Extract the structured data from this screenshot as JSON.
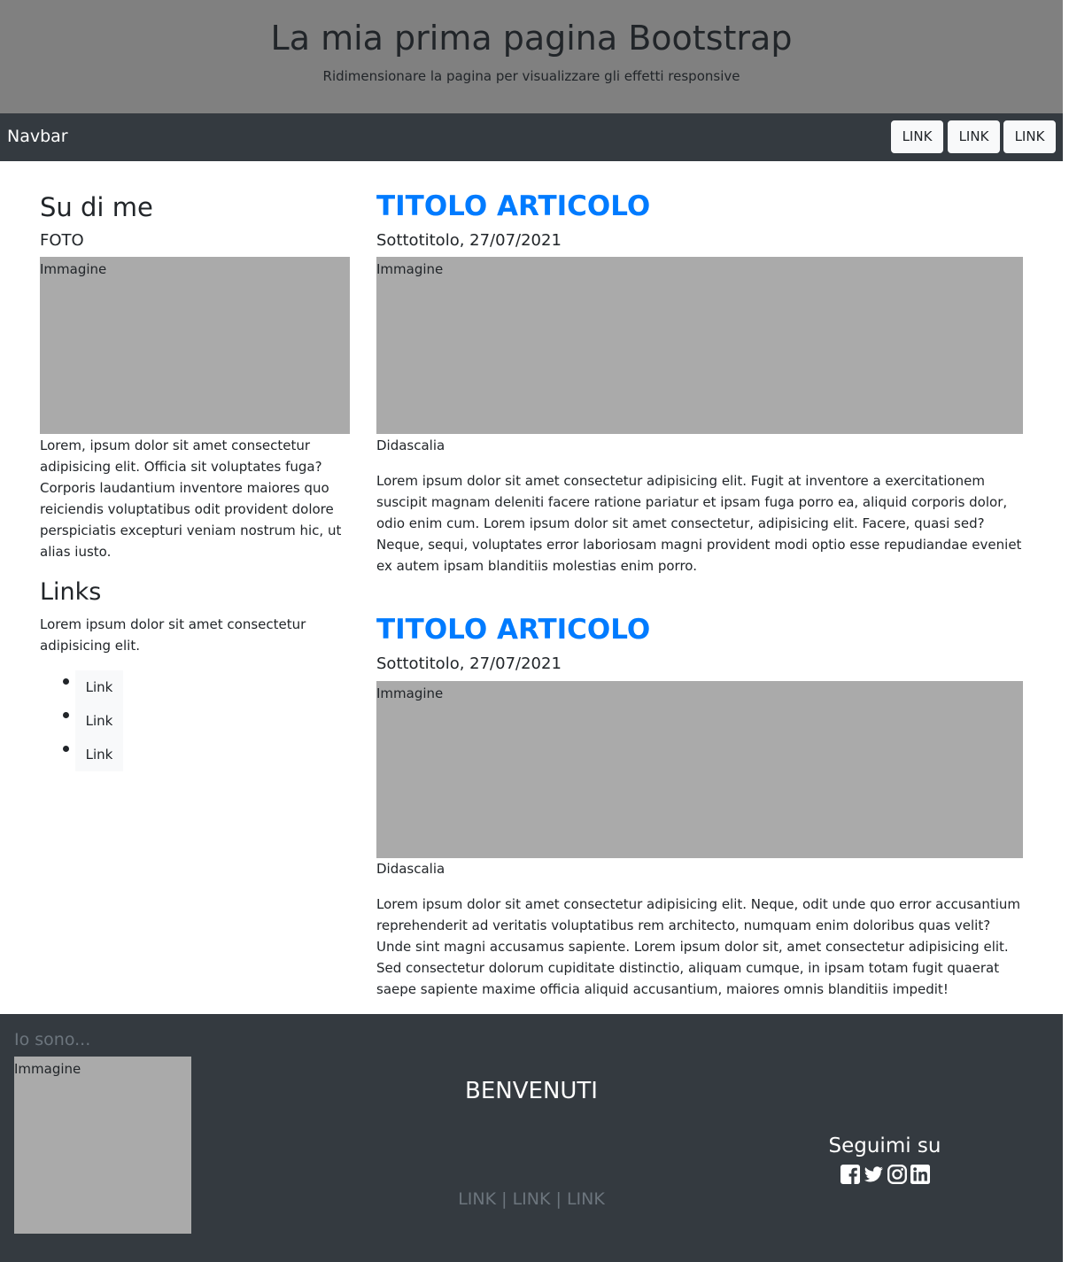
{
  "header": {
    "title": "La mia prima pagina Bootstrap",
    "subtitle": "Ridimensionare la pagina per visualizzare gli effetti responsive"
  },
  "navbar": {
    "brand": "Navbar",
    "links": [
      "LINK",
      "LINK",
      "LINK"
    ]
  },
  "sidebar": {
    "about_heading": "Su di me",
    "photo_label": "FOTO",
    "image_label": "Immagine",
    "about_text": "Lorem, ipsum dolor sit amet consectetur adipisicing elit. Officia sit voluptates fuga? Corporis laudantium inventore maiores quo reiciendis voluptatibus odit provident dolore perspiciatis excepturi veniam nostrum hic, ut alias iusto.",
    "links_heading": "Links",
    "links_text": "Lorem ipsum dolor sit amet consectetur adipisicing elit.",
    "links": [
      "Link",
      "Link",
      "Link"
    ]
  },
  "articles": [
    {
      "title": "TITOLO ARTICOLO",
      "subtitle": "Sottotitolo, 27/07/2021",
      "image_label": "Immagine",
      "caption": "Didascalia",
      "body": "Lorem ipsum dolor sit amet consectetur adipisicing elit. Fugit at inventore a exercitationem suscipit magnam deleniti facere ratione pariatur et ipsam fuga porro ea, aliquid corporis dolor, odio enim cum. Lorem ipsum dolor sit amet consectetur, adipisicing elit. Facere, quasi sed? Neque, sequi, voluptates error laboriosam magni provident modi optio esse repudiandae eveniet ex autem ipsam blanditiis molestias enim porro."
    },
    {
      "title": "TITOLO ARTICOLO",
      "subtitle": "Sottotitolo, 27/07/2021",
      "image_label": "Immagine",
      "caption": "Didascalia",
      "body": "Lorem ipsum dolor sit amet consectetur adipisicing elit. Neque, odit unde quo error accusantium reprehenderit ad veritatis voluptatibus rem architecto, numquam enim doloribus quas velit? Unde sint magni accusamus sapiente. Lorem ipsum dolor sit, amet consectetur adipisicing elit. Sed consectetur dolorum cupiditate distinctio, aliquam cumque, in ipsam totam fugit quaerat saepe sapiente maxime officia aliquid accusantium, maiores omnis blanditiis impedit!"
    }
  ],
  "footer": {
    "iam": "Io sono...",
    "image_label": "Immagine",
    "welcome": "BENVENUTI",
    "links": [
      "LINK",
      "LINK",
      "LINK"
    ],
    "separator": "|",
    "follow": "Seguimi su",
    "socials": [
      "facebook-icon",
      "twitter-icon",
      "instagram-icon",
      "linkedin-icon"
    ]
  },
  "colors": {
    "hero_bg": "#808080",
    "dark_bg": "#343a40",
    "accent": "#007bff",
    "placeholder": "#aaaaaa",
    "muted": "#6c757d"
  }
}
